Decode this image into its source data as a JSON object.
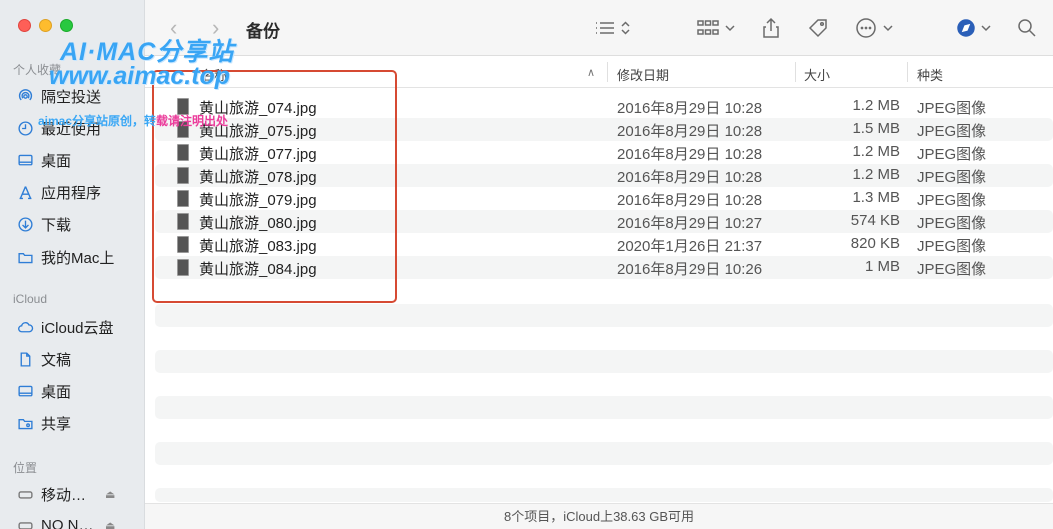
{
  "window": {
    "title": "备份"
  },
  "watermark": {
    "line1": "AI·MAC分享站",
    "line2": "www.aimac.top",
    "line3_a": "aimac分享站原创，转",
    "line3_b": "载请注明出处"
  },
  "sidebar": {
    "sections": [
      {
        "label": "个人收藏"
      },
      {
        "label": "iCloud"
      },
      {
        "label": "位置"
      }
    ],
    "items": [
      {
        "label": "隔空投送",
        "icon": "airdrop-icon"
      },
      {
        "label": "最近使用",
        "icon": "clock-icon"
      },
      {
        "label": "桌面",
        "icon": "desktop-icon"
      },
      {
        "label": "应用程序",
        "icon": "applications-icon"
      },
      {
        "label": "下载",
        "icon": "download-icon"
      },
      {
        "label": "我的Mac上",
        "icon": "folder-icon"
      },
      {
        "label": "iCloud云盘",
        "icon": "cloud-icon"
      },
      {
        "label": "文稿",
        "icon": "document-icon"
      },
      {
        "label": "桌面",
        "icon": "desktop-icon"
      },
      {
        "label": "共享",
        "icon": "shared-folder-icon"
      },
      {
        "label": "移动…",
        "icon": "drive-icon"
      },
      {
        "label": "NO N…",
        "icon": "drive-icon"
      }
    ]
  },
  "columns": {
    "name": "名称",
    "date": "修改日期",
    "size": "大小",
    "kind": "种类"
  },
  "files": [
    {
      "name": "黄山旅游_074.jpg",
      "date": "2016年8月29日 10:28",
      "size": "1.2 MB",
      "kind": "JPEG图像"
    },
    {
      "name": "黄山旅游_075.jpg",
      "date": "2016年8月29日 10:28",
      "size": "1.5 MB",
      "kind": "JPEG图像"
    },
    {
      "name": "黄山旅游_077.jpg",
      "date": "2016年8月29日 10:28",
      "size": "1.2 MB",
      "kind": "JPEG图像"
    },
    {
      "name": "黄山旅游_078.jpg",
      "date": "2016年8月29日 10:28",
      "size": "1.2 MB",
      "kind": "JPEG图像"
    },
    {
      "name": "黄山旅游_079.jpg",
      "date": "2016年8月29日 10:28",
      "size": "1.3 MB",
      "kind": "JPEG图像"
    },
    {
      "name": "黄山旅游_080.jpg",
      "date": "2016年8月29日 10:27",
      "size": "574 KB",
      "kind": "JPEG图像"
    },
    {
      "name": "黄山旅游_083.jpg",
      "date": "2020年1月26日 21:37",
      "size": "820 KB",
      "kind": "JPEG图像"
    },
    {
      "name": "黄山旅游_084.jpg",
      "date": "2016年8月29日 10:26",
      "size": "1 MB",
      "kind": "JPEG图像"
    }
  ],
  "status": {
    "text": "8个项目，iCloud上38.63 GB可用"
  },
  "colors": {
    "accent": "#2e7dd6",
    "highlight_box": "#d64a33"
  }
}
